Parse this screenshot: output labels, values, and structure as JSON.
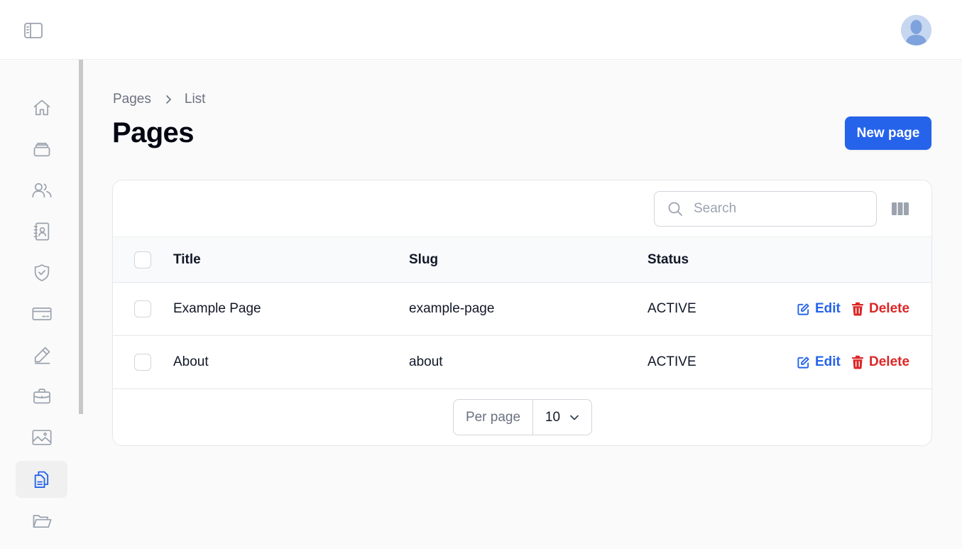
{
  "topbar": {
    "toggle_icon": "sidebar-toggle-icon",
    "avatar_icon": "user-avatar-icon"
  },
  "sidebar": {
    "items": [
      {
        "icon": "home-icon",
        "active": false
      },
      {
        "icon": "stack-icon",
        "active": false
      },
      {
        "icon": "users-icon",
        "active": false
      },
      {
        "icon": "contact-book-icon",
        "active": false
      },
      {
        "icon": "shield-check-icon",
        "active": false
      },
      {
        "icon": "credit-card-icon",
        "active": false
      },
      {
        "icon": "pencil-icon",
        "active": false
      },
      {
        "icon": "briefcase-icon",
        "active": false
      },
      {
        "icon": "image-icon",
        "active": false
      },
      {
        "icon": "document-duplicate-icon",
        "active": true
      },
      {
        "icon": "folder-open-icon",
        "active": false
      }
    ]
  },
  "breadcrumb": {
    "items": [
      "Pages",
      "List"
    ]
  },
  "page": {
    "title": "Pages",
    "new_button": "New page"
  },
  "table": {
    "search_placeholder": "Search",
    "columns": [
      "Title",
      "Slug",
      "Status"
    ],
    "rows": [
      {
        "title": "Example Page",
        "slug": "example-page",
        "status": "ACTIVE",
        "edit": "Edit",
        "delete": "Delete"
      },
      {
        "title": "About",
        "slug": "about",
        "status": "ACTIVE",
        "edit": "Edit",
        "delete": "Delete"
      }
    ],
    "pagination": {
      "per_page_label": "Per page",
      "per_page_value": "10"
    }
  },
  "colors": {
    "primary": "#2563eb",
    "danger": "#dc2626",
    "muted": "#6b7280",
    "icon_gray": "#9ca3af"
  }
}
